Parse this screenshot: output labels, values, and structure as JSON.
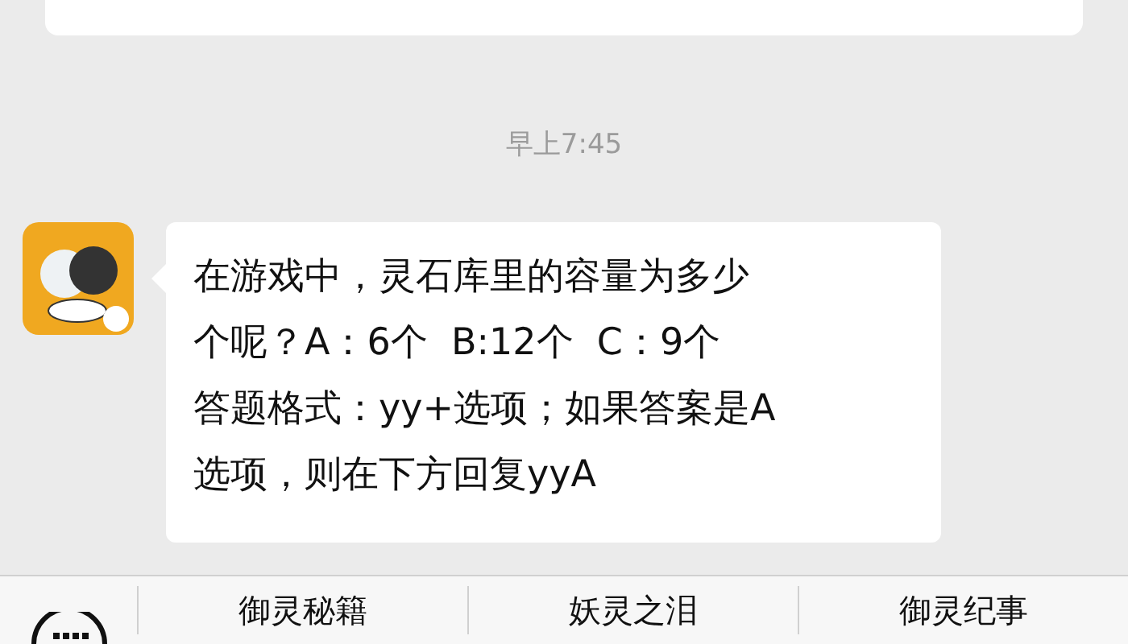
{
  "timestamp": "早上7:45",
  "message": {
    "lines": [
      "在游戏中，灵石库里的容量为多少",
      "个呢？A：6个  B:12个  C：9个",
      "答题格式：yy+选项；如果答案是A",
      "选项，则在下方回复yyA"
    ]
  },
  "menu": {
    "items": [
      "御灵秘籍",
      "妖灵之泪",
      "御灵纪事"
    ]
  }
}
